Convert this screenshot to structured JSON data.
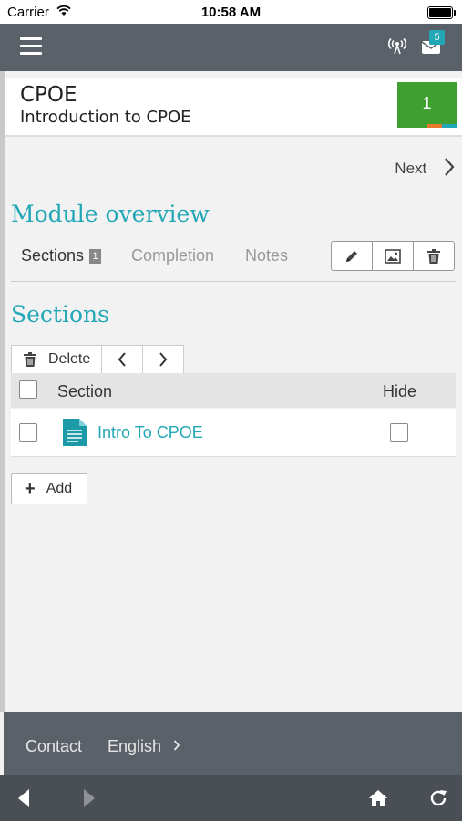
{
  "status_bar": {
    "carrier": "Carrier",
    "time": "10:58 AM"
  },
  "topbar": {
    "notification_count": "5"
  },
  "course": {
    "shortname": "CPOE",
    "fullname": "Introduction to CPOE",
    "progress_value": "1"
  },
  "nav": {
    "next_label": "Next"
  },
  "module": {
    "title": "Module overview",
    "tabs": [
      {
        "label": "Sections",
        "count": "1"
      },
      {
        "label": "Completion"
      },
      {
        "label": "Notes"
      }
    ]
  },
  "sections": {
    "title": "Sections",
    "delete_label": "Delete",
    "columns": {
      "section": "Section",
      "hide": "Hide"
    },
    "rows": [
      {
        "name": "Intro To CPOE"
      }
    ],
    "add_label": "Add"
  },
  "footer": {
    "contact": "Contact",
    "language": "English"
  },
  "colors": {
    "accent": "#21a7b6",
    "topbar": "#5b6169",
    "progress_green": "#3f9f2f"
  }
}
